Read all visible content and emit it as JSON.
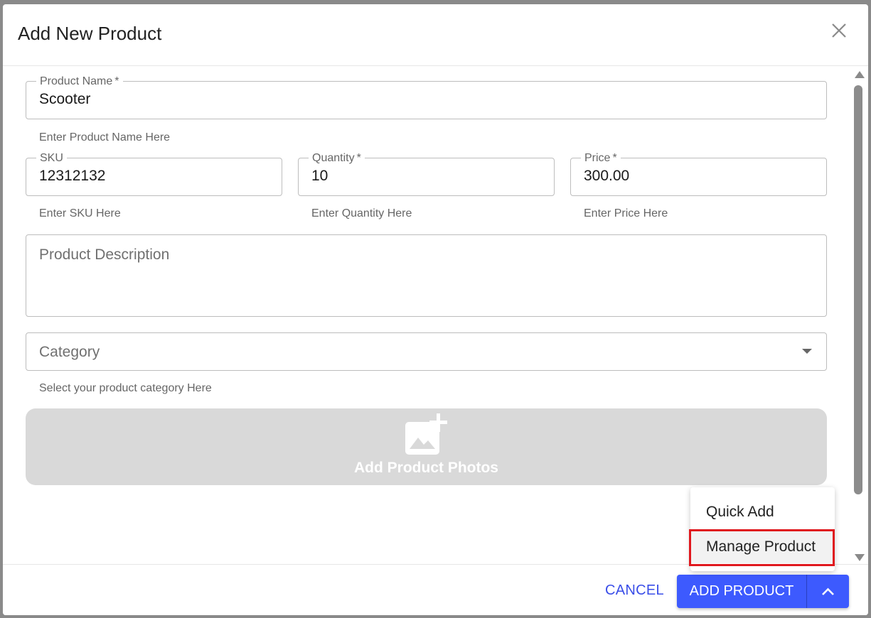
{
  "dialog": {
    "title": "Add New Product"
  },
  "form": {
    "product_name": {
      "label": "Product Name",
      "required_mark": "*",
      "value": "Scooter",
      "helper": "Enter Product Name Here"
    },
    "sku": {
      "label": "SKU",
      "value": "12312132",
      "helper": "Enter SKU Here"
    },
    "quantity": {
      "label": "Quantity",
      "required_mark": "*",
      "value": "10",
      "helper": "Enter Quantity Here"
    },
    "price": {
      "label": "Price",
      "required_mark": "*",
      "value": "300.00",
      "helper": "Enter Price Here"
    },
    "description": {
      "placeholder": "Product Description"
    },
    "category": {
      "placeholder": "Category",
      "helper": "Select your product category Here"
    },
    "photos": {
      "label": "Add Product Photos"
    }
  },
  "menu": {
    "items": [
      {
        "label": "Quick Add"
      },
      {
        "label": "Manage Product"
      }
    ]
  },
  "footer": {
    "cancel_label": "CANCEL",
    "add_label": "ADD PRODUCT"
  },
  "colors": {
    "primary": "#3d5afe",
    "highlight": "#e0181e"
  }
}
